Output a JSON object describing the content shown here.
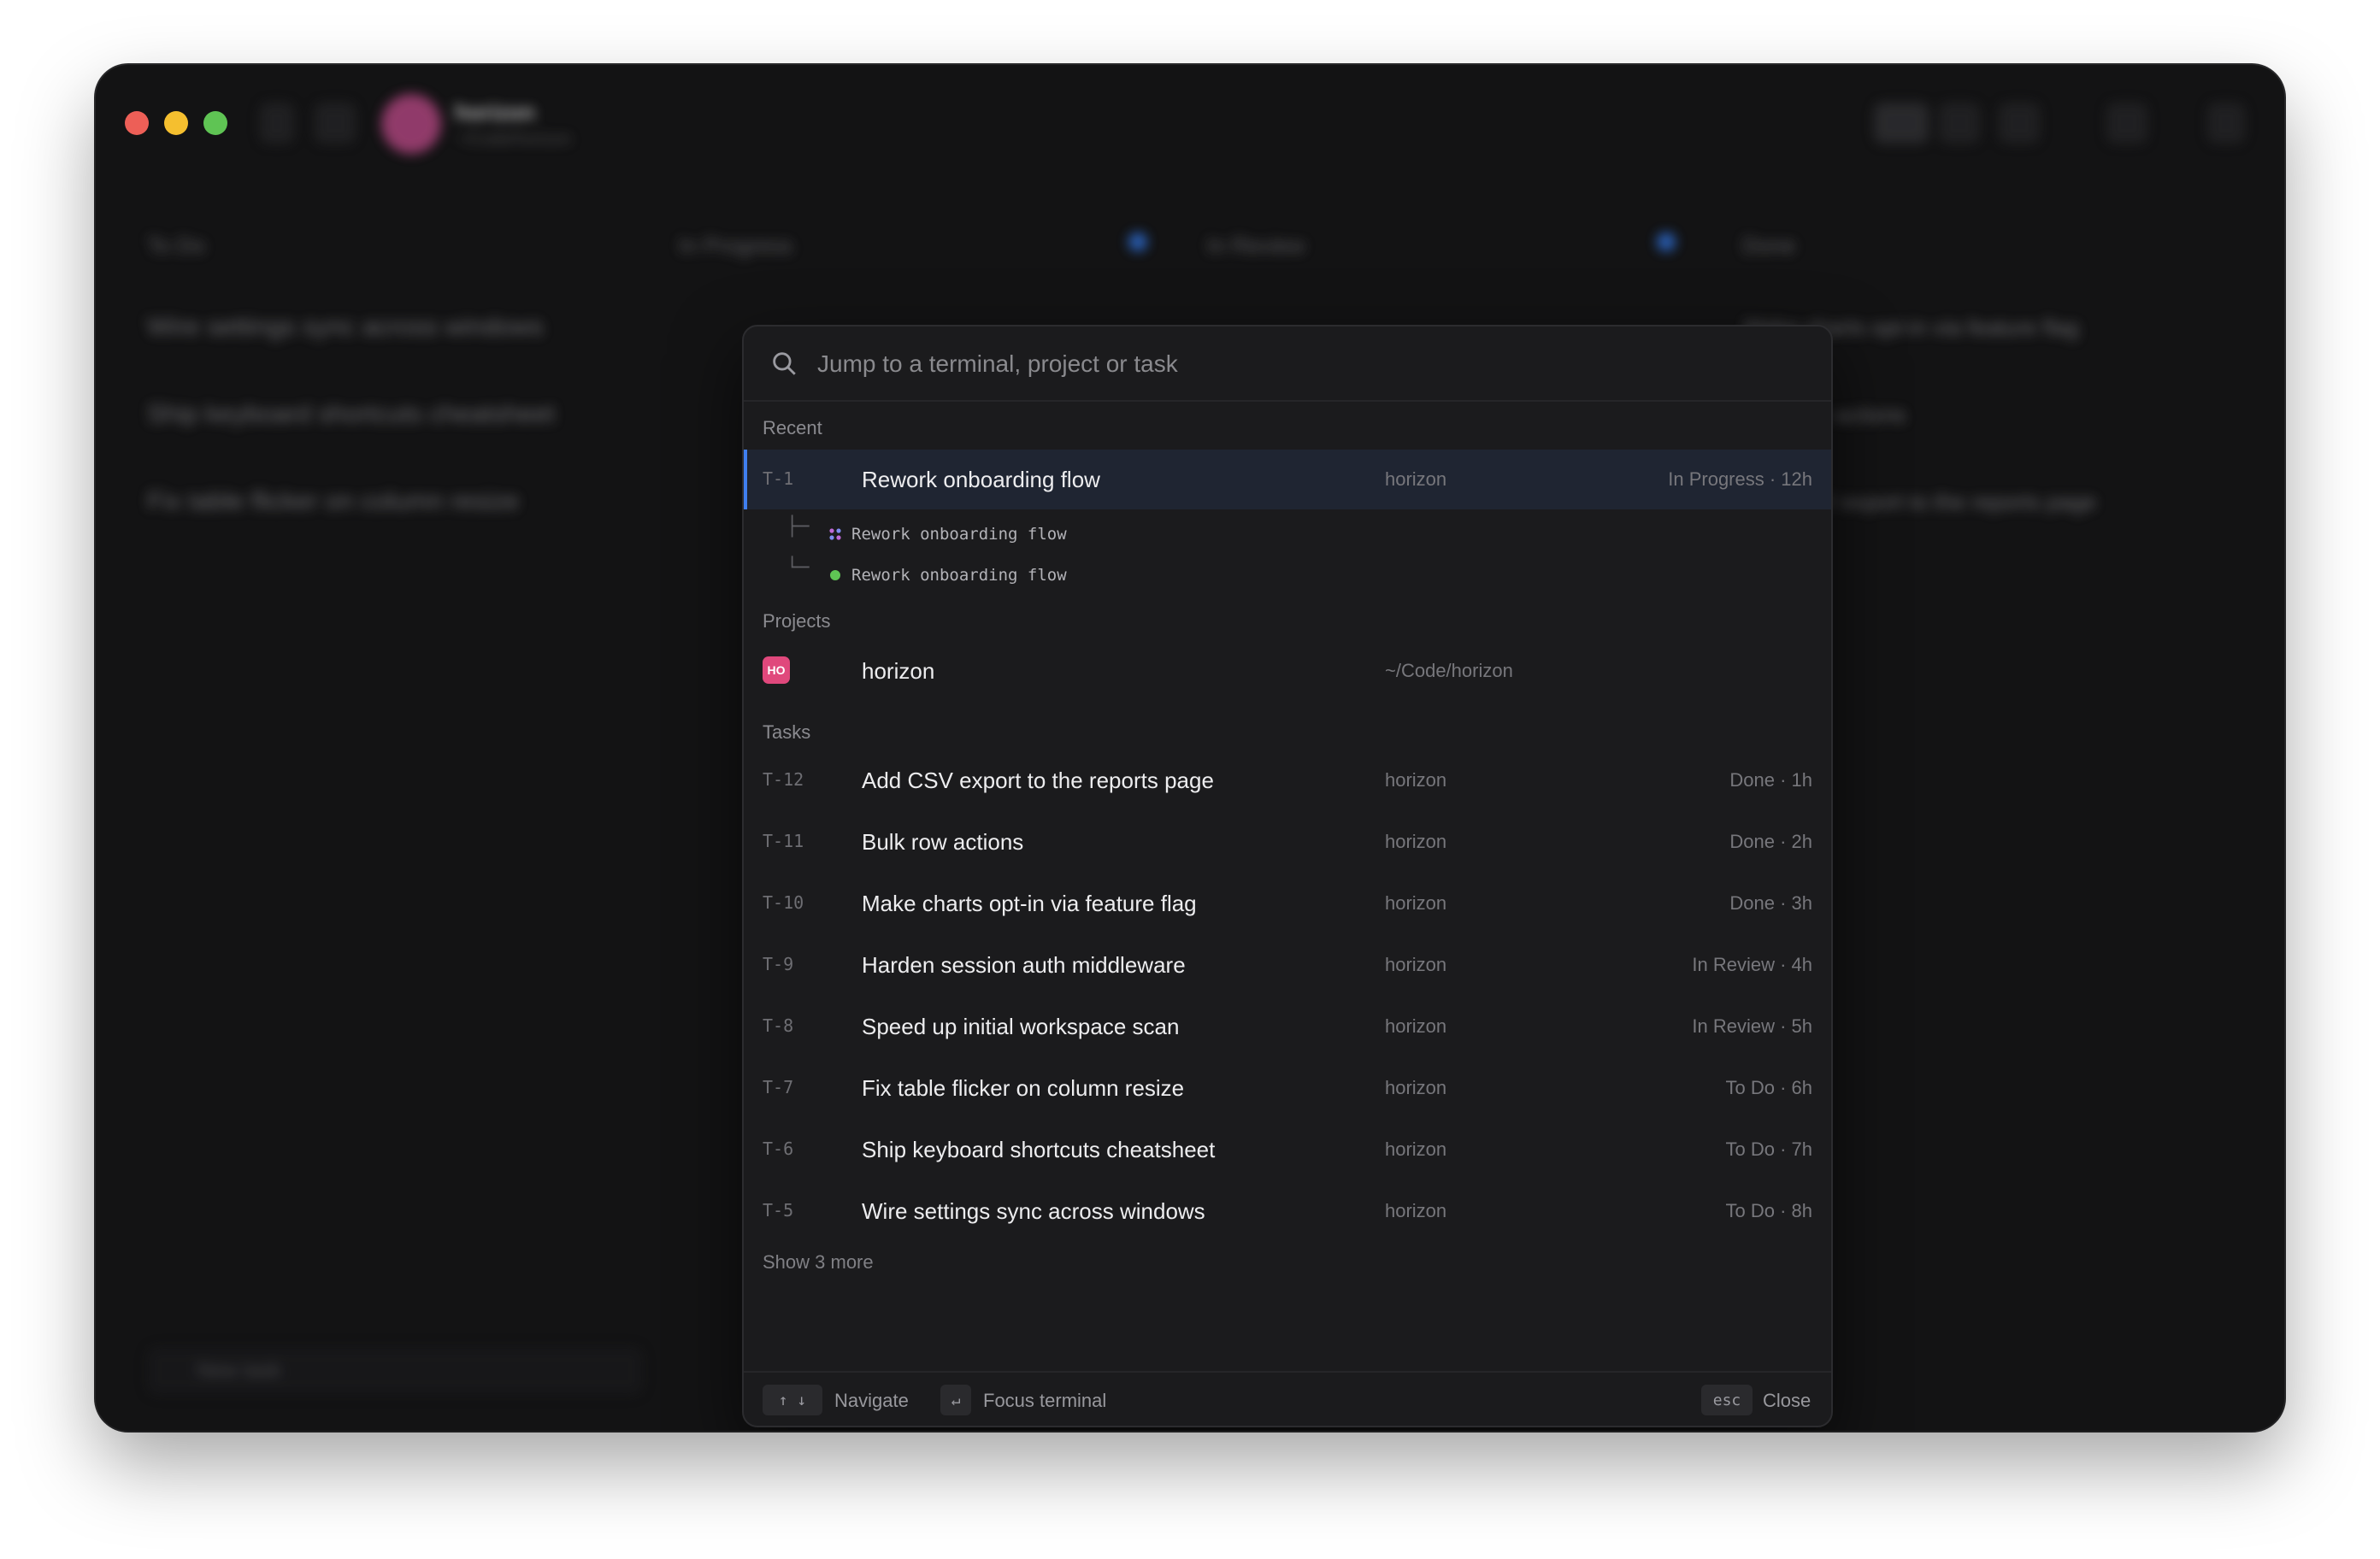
{
  "window": {
    "title": "horizon",
    "subtitle": "~/Code/horizon"
  },
  "background": {
    "columns": [
      {
        "name": "To Do"
      },
      {
        "name": "In Progress"
      },
      {
        "name": "In Review"
      },
      {
        "name": "Done"
      }
    ],
    "todo_cards": [
      "Wire settings sync across windows",
      "Ship keyboard shortcuts cheatsheet",
      "Fix table flicker on column resize"
    ],
    "done_cards": [
      "Make charts opt-in via feature flag",
      "Bulk row actions",
      "Add CSV export to the reports page"
    ],
    "new_task": "New task"
  },
  "palette": {
    "search": {
      "placeholder": "Jump to a terminal, project or task",
      "value": ""
    },
    "recent_label": "Recent",
    "recent": {
      "id": "T-1",
      "title": "Rework onboarding flow",
      "project": "horizon",
      "status": "In Progress · 12h",
      "terminals": [
        {
          "tree": "├─",
          "icon": "agent-icon",
          "label": "Rework onboarding flow"
        },
        {
          "tree": "└─",
          "icon": "status-dot-icon",
          "label": "Rework onboarding flow"
        }
      ]
    },
    "projects_label": "Projects",
    "project": {
      "badge": "HO",
      "name": "horizon",
      "path": "~/Code/horizon"
    },
    "tasks_label": "Tasks",
    "tasks": [
      {
        "id": "T-12",
        "title": "Add CSV export to the reports page",
        "project": "horizon",
        "status": "Done · 1h"
      },
      {
        "id": "T-11",
        "title": "Bulk row actions",
        "project": "horizon",
        "status": "Done · 2h"
      },
      {
        "id": "T-10",
        "title": "Make charts opt-in via feature flag",
        "project": "horizon",
        "status": "Done · 3h"
      },
      {
        "id": "T-9",
        "title": "Harden session auth middleware",
        "project": "horizon",
        "status": "In Review · 4h"
      },
      {
        "id": "T-8",
        "title": "Speed up initial workspace scan",
        "project": "horizon",
        "status": "In Review · 5h"
      },
      {
        "id": "T-7",
        "title": "Fix table flicker on column resize",
        "project": "horizon",
        "status": "To Do · 6h"
      },
      {
        "id": "T-6",
        "title": "Ship keyboard shortcuts cheatsheet",
        "project": "horizon",
        "status": "To Do · 7h"
      },
      {
        "id": "T-5",
        "title": "Wire settings sync across windows",
        "project": "horizon",
        "status": "To Do · 8h"
      }
    ],
    "show_more": "Show 3 more",
    "footer": {
      "navigate_key": "↑ ↓",
      "navigate_label": "Navigate",
      "focus_key": "↵",
      "focus_label": "Focus terminal",
      "close_key": "esc",
      "close_label": "Close"
    }
  },
  "colors": {
    "accent": "#3f7ff0",
    "project_badge": "#e0487c",
    "status_dot": "#5fc454",
    "agent_icon": "#c06ad8"
  }
}
